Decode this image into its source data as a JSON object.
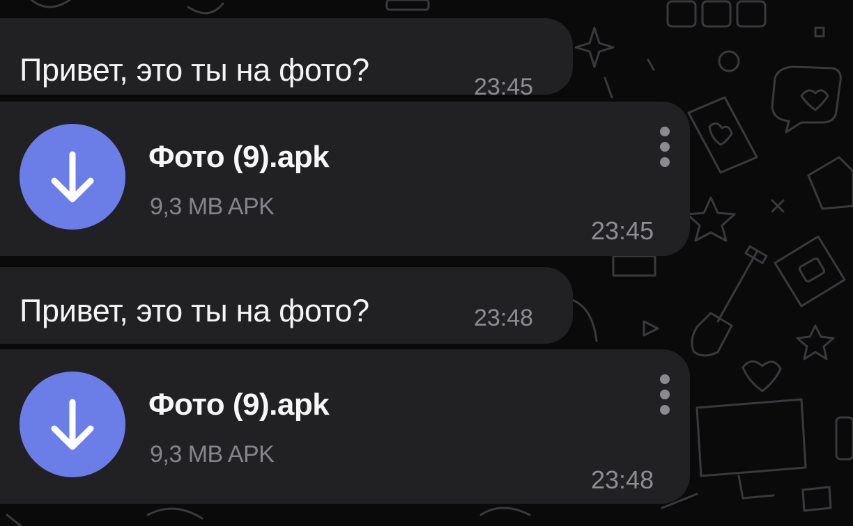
{
  "messages": [
    {
      "type": "text",
      "text": "Привет, это ты на фото?",
      "time": "23:45"
    },
    {
      "type": "file",
      "file_name": "Фото (9).apk",
      "file_meta": "9,3 MB APK",
      "time": "23:45",
      "action_icon": "download-arrow-icon",
      "menu_icon": "more-vertical-icon"
    },
    {
      "type": "text",
      "text": "Привет, это ты на фото?",
      "time": "23:48"
    },
    {
      "type": "file",
      "file_name": "Фото (9).apk",
      "file_meta": "9,3 MB APK",
      "time": "23:48",
      "action_icon": "download-arrow-icon",
      "menu_icon": "more-vertical-icon"
    }
  ],
  "colors": {
    "background": "#0a0a0b",
    "bubble": "#212123",
    "accent": "#6b7ee8",
    "text": "#f4f4f4",
    "secondary_text": "#8d8d92"
  }
}
